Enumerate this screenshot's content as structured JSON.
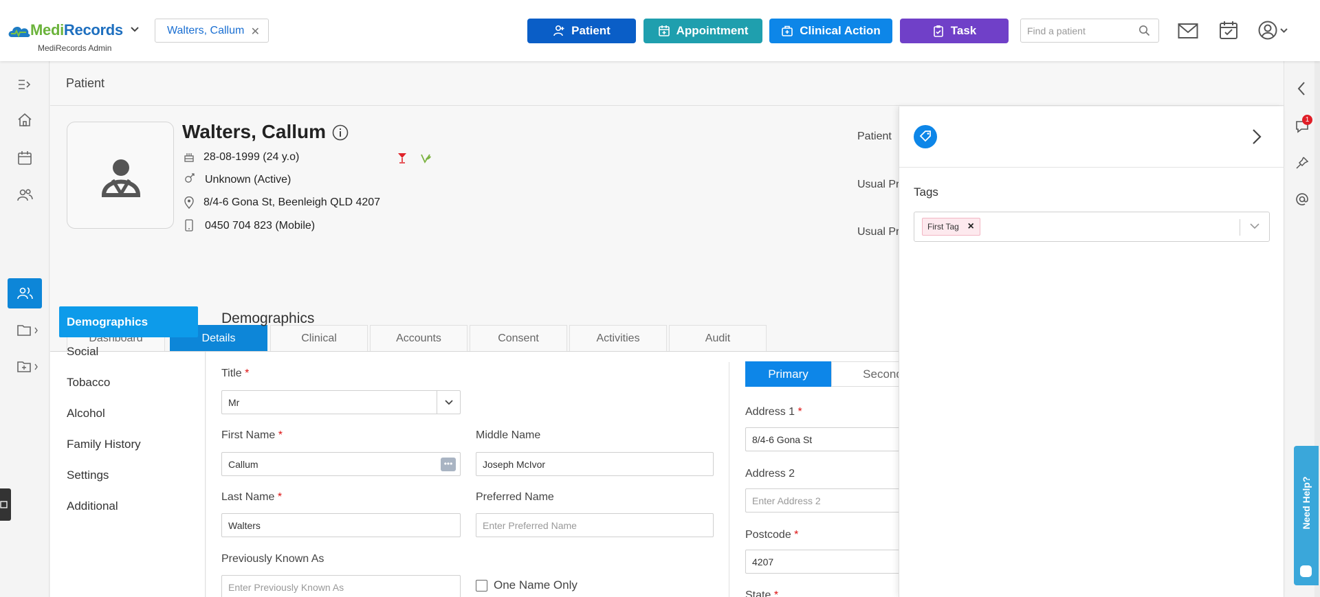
{
  "brand": {
    "name_part1": "Medi",
    "name_part2": "Records",
    "subtitle": "MediRecords Admin"
  },
  "header": {
    "open_patient": "Walters, Callum",
    "buttons": {
      "patient": "Patient",
      "appointment": "Appointment",
      "clinical_action": "Clinical Action",
      "task": "Task"
    },
    "search_placeholder": "Find a patient"
  },
  "colors": {
    "patient": "#0a5ec7",
    "appointment": "#1f9fae",
    "clinical_action": "#0d86e8",
    "task": "#7040c8",
    "accent": "#0d86d8"
  },
  "page": {
    "title": "Patient"
  },
  "patient": {
    "name": "Walters, Callum",
    "dob": "28-08-1999 (24 y.o)",
    "gender": "Unknown (Active)",
    "address": "8/4-6 Gona St, Beenleigh QLD 4207",
    "phone": "0450 704 823 (Mobile)",
    "right_labels": [
      "Patient",
      "Usual Pr",
      "Usual Pr"
    ]
  },
  "tabs": [
    "Dashboard",
    "Details",
    "Clinical",
    "Accounts",
    "Consent",
    "Activities",
    "Audit"
  ],
  "active_tab": "Details",
  "side_menu": [
    "Demographics",
    "Social",
    "Tobacco",
    "Alcohol",
    "Family History",
    "Settings",
    "Additional"
  ],
  "section": {
    "title": "Demographics"
  },
  "form": {
    "title_label": "Title",
    "title_value": "Mr",
    "first_name_label": "First Name",
    "first_name_value": "Callum",
    "middle_name_label": "Middle Name",
    "middle_name_value": "Joseph McIvor",
    "last_name_label": "Last Name",
    "last_name_value": "Walters",
    "preferred_name_label": "Preferred Name",
    "preferred_name_placeholder": "Enter Preferred Name",
    "prev_known_label": "Previously Known As",
    "prev_known_placeholder": "Enter Previously Known As",
    "one_name_label": "One Name Only",
    "required_mark": "*"
  },
  "address": {
    "tabs": [
      "Primary",
      "Second"
    ],
    "address1_label": "Address 1",
    "address1_value": "8/4-6 Gona St",
    "address2_label": "Address 2",
    "address2_placeholder": "Enter Address 2",
    "postcode_label": "Postcode",
    "postcode_value": "4207",
    "state_label": "State"
  },
  "tags_panel": {
    "label": "Tags",
    "tags": [
      "First Tag"
    ],
    "remove_glyph": "×"
  },
  "rail": {
    "chat_badge": "1"
  },
  "help": {
    "label": "Need Help?"
  }
}
